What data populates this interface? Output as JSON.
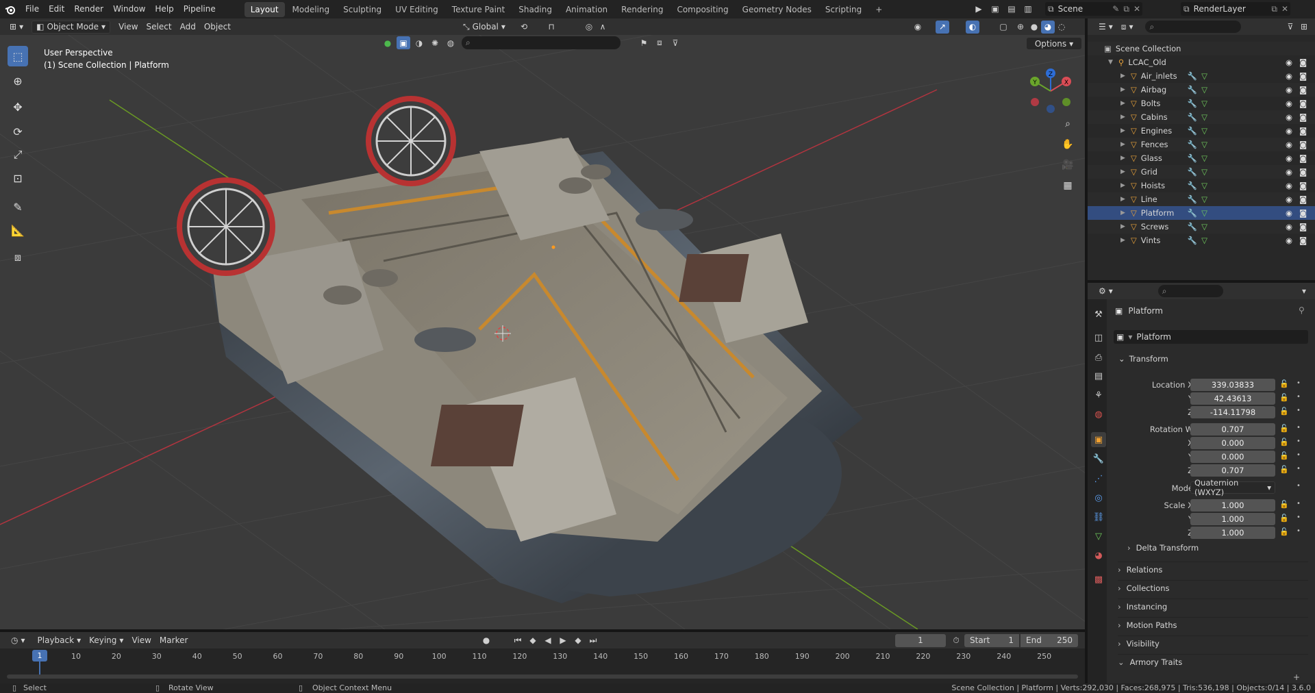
{
  "topbar": {
    "menus": [
      "File",
      "Edit",
      "Render",
      "Window",
      "Help",
      "Pipeline"
    ],
    "workspaces": [
      "Layout",
      "Modeling",
      "Sculpting",
      "UV Editing",
      "Texture Paint",
      "Shading",
      "Animation",
      "Rendering",
      "Compositing",
      "Geometry Nodes",
      "Scripting"
    ],
    "active_workspace": "Layout",
    "add_tab": "+",
    "scene_name": "Scene",
    "render_layer": "RenderLayer"
  },
  "viewport_header": {
    "mode": "Object Mode",
    "menus": [
      "View",
      "Select",
      "Add",
      "Object"
    ],
    "transform_orientation": "Global",
    "options_label": "Options"
  },
  "viewport": {
    "overlay_title": "User Perspective",
    "overlay_subtitle": "(1) Scene Collection | Platform",
    "gizmo_axes": {
      "x": "X",
      "y": "Y",
      "z": "Z"
    },
    "tools": [
      "select-box",
      "cursor",
      "move",
      "rotate",
      "scale",
      "transform",
      "annotate",
      "measure",
      "add-cube"
    ],
    "scene_colors": {
      "floor": "#3b3b3b",
      "grid": "#454545",
      "x_axis": "#b3343f",
      "y_axis": "#6a9a24"
    }
  },
  "outliner": {
    "root": "Scene Collection",
    "collection": "LCAC_Old",
    "objects": [
      "Air_inlets",
      "Airbag",
      "Bolts",
      "Cabins",
      "Engines",
      "Fences",
      "Glass",
      "Grid",
      "Hoists",
      "Line",
      "Platform",
      "Screws",
      "Vints"
    ],
    "selected": "Platform"
  },
  "properties": {
    "object_name": "Platform",
    "datablock_name": "Platform",
    "transform_header": "Transform",
    "location_label": "Location X",
    "location": [
      "339.03833",
      "42.43613",
      "-114.11798"
    ],
    "rotation_label": "Rotation W",
    "rotation": [
      "0.707",
      "0.000",
      "0.000",
      "0.707"
    ],
    "axis_y": "Y",
    "axis_z": "Z",
    "axis_x": "X",
    "mode_label": "Mode",
    "mode_value": "Quaternion (WXYZ)",
    "scale_label": "Scale X",
    "scale": [
      "1.000",
      "1.000",
      "1.000"
    ],
    "panels": [
      "Delta Transform",
      "Relations",
      "Collections",
      "Instancing",
      "Motion Paths",
      "Visibility",
      "Armory Traits"
    ]
  },
  "timeline": {
    "menus": [
      "Playback",
      "Keying",
      "View",
      "Marker"
    ],
    "current_frame": "1",
    "start_label": "Start",
    "start": "1",
    "end_label": "End",
    "end": "250",
    "ruler": [
      "10",
      "20",
      "30",
      "40",
      "50",
      "60",
      "70",
      "80",
      "90",
      "100",
      "110",
      "120",
      "130",
      "140",
      "150",
      "160",
      "170",
      "180",
      "190",
      "200",
      "210",
      "220",
      "230",
      "240",
      "250"
    ]
  },
  "status": {
    "left": "Select",
    "middle": "Rotate View",
    "right": "Object Context Menu",
    "stats": "Scene Collection | Platform | Verts:292,030 | Faces:268,975 | Tris:536,198 | Objects:0/14 | 3.6.0"
  }
}
